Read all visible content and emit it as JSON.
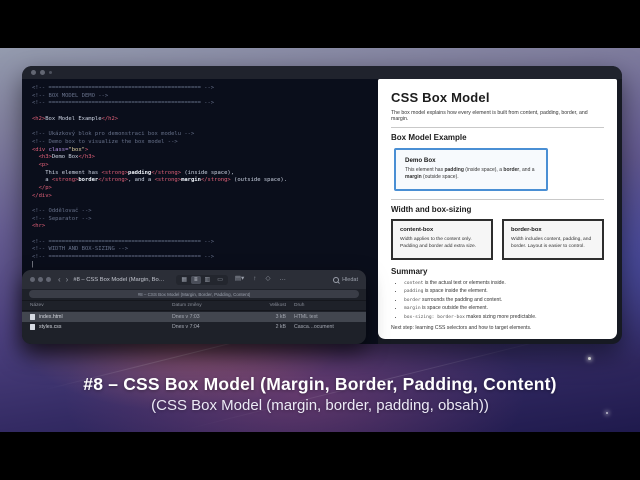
{
  "colors": {
    "accent_blue": "#4a8fd4",
    "editor_background": "#0a0e1b",
    "editor_tag": "#e06078",
    "editor_comment": "#67718a",
    "finder_selected_row": "#42464f",
    "wallpaper_purple": "#4d417f"
  },
  "editor": {
    "lines": [
      {
        "segments": [
          [
            "c",
            "<!-- ============================================== -->"
          ]
        ]
      },
      {
        "segments": [
          [
            "c",
            "<!-- BOX MODEL DEMO -->"
          ]
        ]
      },
      {
        "segments": [
          [
            "c",
            "<!-- ============================================== -->"
          ]
        ]
      },
      {
        "segments": [
          [
            "x",
            ""
          ]
        ]
      },
      {
        "segments": [
          [
            "t",
            "<h2>"
          ],
          [
            "x",
            "Box Model Example"
          ],
          [
            "t",
            "</h2>"
          ]
        ]
      },
      {
        "segments": [
          [
            "x",
            ""
          ]
        ]
      },
      {
        "segments": [
          [
            "c",
            "<!-- Ukázkový blok pro demonstraci box modelu -->"
          ]
        ]
      },
      {
        "segments": [
          [
            "c",
            "<!-- Demo box to visualize the box model -->"
          ]
        ]
      },
      {
        "segments": [
          [
            "t",
            "<div "
          ],
          [
            "a",
            "class="
          ],
          [
            "s",
            "\"box\""
          ],
          [
            "t",
            ">"
          ]
        ]
      },
      {
        "segments": [
          [
            "x",
            "  "
          ],
          [
            "t",
            "<h3>"
          ],
          [
            "x",
            "Demo Box"
          ],
          [
            "t",
            "</h3>"
          ]
        ]
      },
      {
        "segments": [
          [
            "x",
            "  "
          ],
          [
            "t",
            "<p>"
          ]
        ]
      },
      {
        "segments": [
          [
            "x",
            "    This element has "
          ],
          [
            "t",
            "<strong>"
          ],
          [
            "b",
            "padding"
          ],
          [
            "t",
            "</strong>"
          ],
          [
            "x",
            " (inside space),"
          ]
        ]
      },
      {
        "segments": [
          [
            "x",
            "    a "
          ],
          [
            "t",
            "<strong>"
          ],
          [
            "b",
            "border"
          ],
          [
            "t",
            "</strong>"
          ],
          [
            "x",
            ", and a "
          ],
          [
            "t",
            "<strong>"
          ],
          [
            "b",
            "margin"
          ],
          [
            "t",
            "</strong>"
          ],
          [
            "x",
            " (outside space)."
          ]
        ]
      },
      {
        "segments": [
          [
            "x",
            "  "
          ],
          [
            "t",
            "</p>"
          ]
        ]
      },
      {
        "segments": [
          [
            "t",
            "</div>"
          ]
        ]
      },
      {
        "segments": [
          [
            "x",
            ""
          ]
        ]
      },
      {
        "segments": [
          [
            "c",
            "<!-- Oddělovač -->"
          ]
        ]
      },
      {
        "segments": [
          [
            "c",
            "<!-- Separator -->"
          ]
        ]
      },
      {
        "segments": [
          [
            "t",
            "<hr>"
          ]
        ]
      },
      {
        "segments": [
          [
            "x",
            ""
          ]
        ]
      },
      {
        "segments": [
          [
            "c",
            "<!-- ============================================== -->"
          ]
        ]
      },
      {
        "segments": [
          [
            "c",
            "<!-- WIDTH AND BOX-SIZING -->"
          ]
        ]
      },
      {
        "segments": [
          [
            "c",
            "<!-- ============================================== -->"
          ]
        ]
      },
      {
        "segments": [
          [
            "b",
            "▏"
          ]
        ]
      }
    ]
  },
  "browser": {
    "title": "CSS Box Model",
    "intro": "The box model explains how every element is built from content, padding, border, and margin.",
    "section1": "Box Model Example",
    "demo": {
      "title": "Demo Box",
      "t1": "This element has ",
      "b1": "padding",
      "t2": " (inside space), a ",
      "b2": "border",
      "t3": ", and a ",
      "b3": "margin",
      "t4": " (outside space)."
    },
    "section2": "Width and box-sizing",
    "cards": [
      {
        "title": "content-box",
        "text": "Width applies to the content only. Padding and border add extra size."
      },
      {
        "title": "border-box",
        "text": "Width includes content, padding, and border. Layout is easier to control."
      }
    ],
    "section3": "Summary",
    "summary": [
      {
        "code": "content",
        "text": " is the actual text or elements inside."
      },
      {
        "code": "padding",
        "text": " is space inside the element."
      },
      {
        "code": "border",
        "text": " surrounds the padding and content."
      },
      {
        "code": "margin",
        "text": " is space outside the element."
      },
      {
        "code": "box-sizing: border-box",
        "text": " makes sizing more predictable."
      }
    ],
    "next": "Next step: learning CSS selectors and how to target elements."
  },
  "finder": {
    "title": "#8 – CSS Box Model (Margin, Borde…",
    "path_pill": "#8 – CSS Box Model (Margin, Border, Padding, Content)",
    "search_label": "Hledat",
    "icons": {
      "back": "‹",
      "forward": "›",
      "grid": "▦",
      "list": "≡",
      "columns": "▥",
      "gallery": "▭",
      "group": "▤▾",
      "share": "↑",
      "tag": "◇",
      "more": "…"
    },
    "columns": {
      "name": "Název",
      "date": "Datum změny",
      "size": "Velikost",
      "kind": "Druh"
    },
    "files": [
      {
        "name": "index.html",
        "date": "Dnes v 7:03",
        "size": "3 kB",
        "kind": "HTML text",
        "selected": true
      },
      {
        "name": "styles.css",
        "date": "Dnes v 7:04",
        "size": "2 kB",
        "kind": "Casca…ocument"
      }
    ]
  },
  "caption": {
    "line1": "#8 – CSS Box Model (Margin, Border, Padding, Content)",
    "line2": "(CSS Box Model (margin, border, padding, obsah))"
  }
}
